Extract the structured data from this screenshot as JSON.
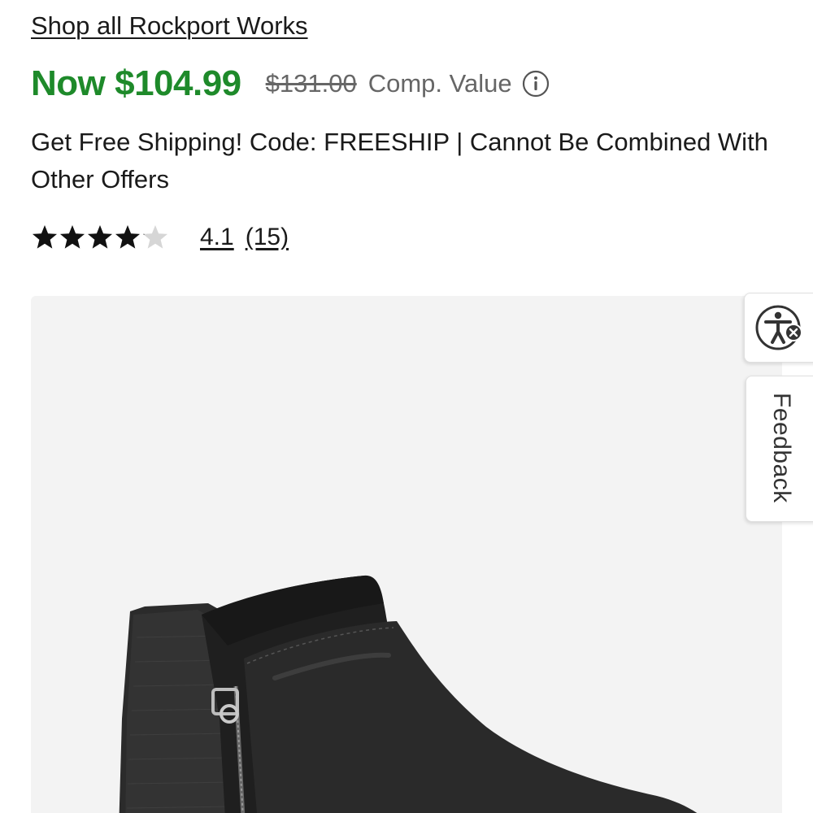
{
  "product": {
    "brand_link": "Shop all Rockport Works",
    "sale_price": "Now $104.99",
    "original_price": "$131.00",
    "comp_value_label": "Comp. Value",
    "shipping_promo": "Get Free Shipping! Code: FREESHIP | Cannot Be Combined With Other Offers",
    "rating": {
      "value": "4.1",
      "count": "(15)",
      "stars_filled_fraction": 0.82
    },
    "image_icon": "ankle-boot-icon"
  },
  "side_widgets": {
    "accessibility_icon": "accessibility-icon",
    "feedback_label": "Feedback"
  },
  "colors": {
    "sale_price": "#1e8a2a",
    "text": "#1a1a1a",
    "muted": "#666666",
    "image_bg": "#f3f3f3"
  }
}
